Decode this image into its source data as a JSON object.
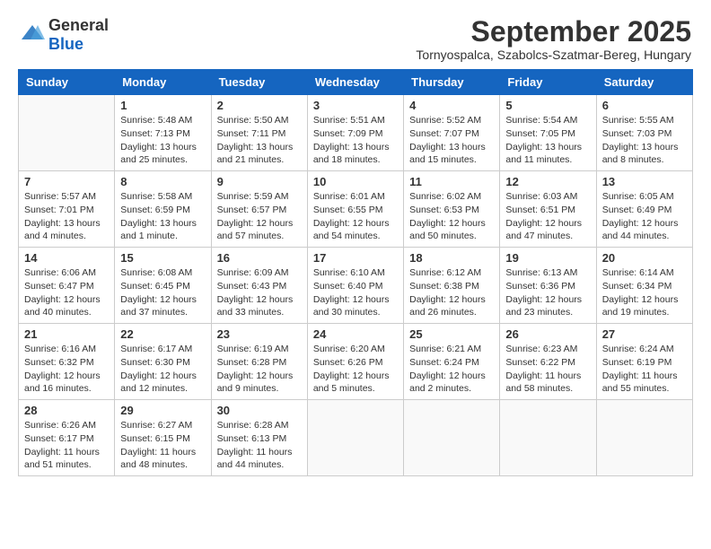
{
  "logo": {
    "text_general": "General",
    "text_blue": "Blue"
  },
  "title": {
    "month": "September 2025",
    "location": "Tornyospalca, Szabolcs-Szatmar-Bereg, Hungary"
  },
  "weekdays": [
    "Sunday",
    "Monday",
    "Tuesday",
    "Wednesday",
    "Thursday",
    "Friday",
    "Saturday"
  ],
  "weeks": [
    [
      {
        "day": "",
        "info": ""
      },
      {
        "day": "1",
        "info": "Sunrise: 5:48 AM\nSunset: 7:13 PM\nDaylight: 13 hours and 25 minutes."
      },
      {
        "day": "2",
        "info": "Sunrise: 5:50 AM\nSunset: 7:11 PM\nDaylight: 13 hours and 21 minutes."
      },
      {
        "day": "3",
        "info": "Sunrise: 5:51 AM\nSunset: 7:09 PM\nDaylight: 13 hours and 18 minutes."
      },
      {
        "day": "4",
        "info": "Sunrise: 5:52 AM\nSunset: 7:07 PM\nDaylight: 13 hours and 15 minutes."
      },
      {
        "day": "5",
        "info": "Sunrise: 5:54 AM\nSunset: 7:05 PM\nDaylight: 13 hours and 11 minutes."
      },
      {
        "day": "6",
        "info": "Sunrise: 5:55 AM\nSunset: 7:03 PM\nDaylight: 13 hours and 8 minutes."
      }
    ],
    [
      {
        "day": "7",
        "info": "Sunrise: 5:57 AM\nSunset: 7:01 PM\nDaylight: 13 hours and 4 minutes."
      },
      {
        "day": "8",
        "info": "Sunrise: 5:58 AM\nSunset: 6:59 PM\nDaylight: 13 hours and 1 minute."
      },
      {
        "day": "9",
        "info": "Sunrise: 5:59 AM\nSunset: 6:57 PM\nDaylight: 12 hours and 57 minutes."
      },
      {
        "day": "10",
        "info": "Sunrise: 6:01 AM\nSunset: 6:55 PM\nDaylight: 12 hours and 54 minutes."
      },
      {
        "day": "11",
        "info": "Sunrise: 6:02 AM\nSunset: 6:53 PM\nDaylight: 12 hours and 50 minutes."
      },
      {
        "day": "12",
        "info": "Sunrise: 6:03 AM\nSunset: 6:51 PM\nDaylight: 12 hours and 47 minutes."
      },
      {
        "day": "13",
        "info": "Sunrise: 6:05 AM\nSunset: 6:49 PM\nDaylight: 12 hours and 44 minutes."
      }
    ],
    [
      {
        "day": "14",
        "info": "Sunrise: 6:06 AM\nSunset: 6:47 PM\nDaylight: 12 hours and 40 minutes."
      },
      {
        "day": "15",
        "info": "Sunrise: 6:08 AM\nSunset: 6:45 PM\nDaylight: 12 hours and 37 minutes."
      },
      {
        "day": "16",
        "info": "Sunrise: 6:09 AM\nSunset: 6:43 PM\nDaylight: 12 hours and 33 minutes."
      },
      {
        "day": "17",
        "info": "Sunrise: 6:10 AM\nSunset: 6:40 PM\nDaylight: 12 hours and 30 minutes."
      },
      {
        "day": "18",
        "info": "Sunrise: 6:12 AM\nSunset: 6:38 PM\nDaylight: 12 hours and 26 minutes."
      },
      {
        "day": "19",
        "info": "Sunrise: 6:13 AM\nSunset: 6:36 PM\nDaylight: 12 hours and 23 minutes."
      },
      {
        "day": "20",
        "info": "Sunrise: 6:14 AM\nSunset: 6:34 PM\nDaylight: 12 hours and 19 minutes."
      }
    ],
    [
      {
        "day": "21",
        "info": "Sunrise: 6:16 AM\nSunset: 6:32 PM\nDaylight: 12 hours and 16 minutes."
      },
      {
        "day": "22",
        "info": "Sunrise: 6:17 AM\nSunset: 6:30 PM\nDaylight: 12 hours and 12 minutes."
      },
      {
        "day": "23",
        "info": "Sunrise: 6:19 AM\nSunset: 6:28 PM\nDaylight: 12 hours and 9 minutes."
      },
      {
        "day": "24",
        "info": "Sunrise: 6:20 AM\nSunset: 6:26 PM\nDaylight: 12 hours and 5 minutes."
      },
      {
        "day": "25",
        "info": "Sunrise: 6:21 AM\nSunset: 6:24 PM\nDaylight: 12 hours and 2 minutes."
      },
      {
        "day": "26",
        "info": "Sunrise: 6:23 AM\nSunset: 6:22 PM\nDaylight: 11 hours and 58 minutes."
      },
      {
        "day": "27",
        "info": "Sunrise: 6:24 AM\nSunset: 6:19 PM\nDaylight: 11 hours and 55 minutes."
      }
    ],
    [
      {
        "day": "28",
        "info": "Sunrise: 6:26 AM\nSunset: 6:17 PM\nDaylight: 11 hours and 51 minutes."
      },
      {
        "day": "29",
        "info": "Sunrise: 6:27 AM\nSunset: 6:15 PM\nDaylight: 11 hours and 48 minutes."
      },
      {
        "day": "30",
        "info": "Sunrise: 6:28 AM\nSunset: 6:13 PM\nDaylight: 11 hours and 44 minutes."
      },
      {
        "day": "",
        "info": ""
      },
      {
        "day": "",
        "info": ""
      },
      {
        "day": "",
        "info": ""
      },
      {
        "day": "",
        "info": ""
      }
    ]
  ]
}
